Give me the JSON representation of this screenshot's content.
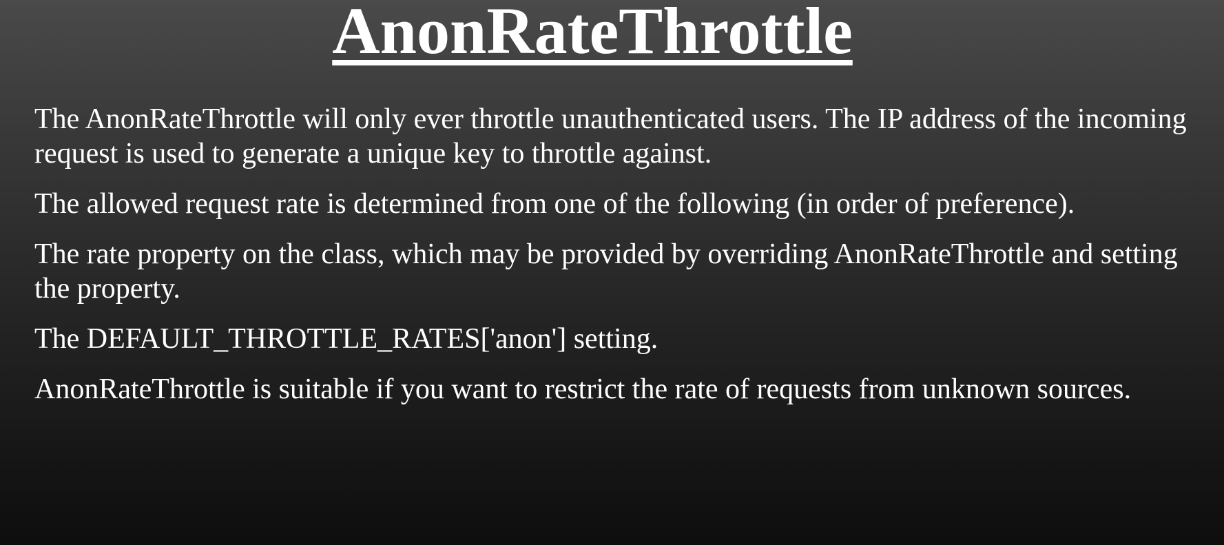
{
  "slide": {
    "title": "AnonRateThrottle",
    "paragraphs": [
      "The AnonRateThrottle will only ever throttle unauthenticated users. The IP address of the incoming request is used to generate a unique key to throttle against.",
      "The allowed request rate is determined from one of the following (in order of preference).",
      "The rate property on the class, which may be provided by overriding AnonRateThrottle and setting the property.",
      "The DEFAULT_THROTTLE_RATES['anon'] setting.",
      "AnonRateThrottle is suitable if you want to restrict the rate of requests from unknown sources."
    ]
  },
  "colors": {
    "background_top": "#4a4a4a",
    "background_bottom": "#0e0e0e",
    "text": "#ffffff"
  }
}
